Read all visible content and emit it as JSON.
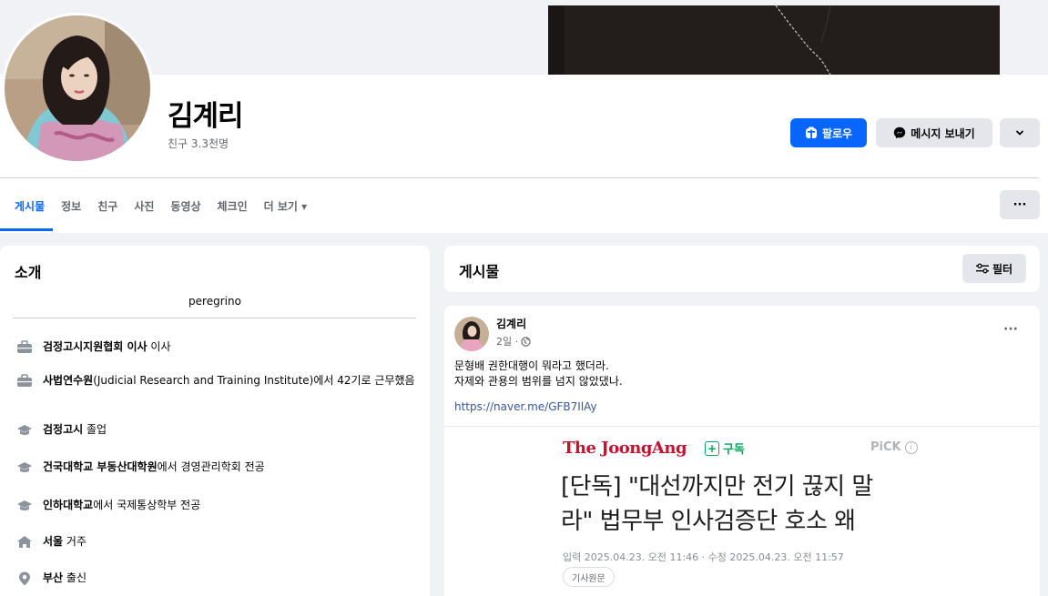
{
  "profile": {
    "name": "김계리",
    "friends": "친구 3.3천명",
    "follow_label": "팔로우",
    "message_label": "메시지 보내기"
  },
  "tabs": [
    {
      "label": "게시물",
      "active": true
    },
    {
      "label": "정보"
    },
    {
      "label": "친구"
    },
    {
      "label": "사진"
    },
    {
      "label": "동영상"
    },
    {
      "label": "체크인"
    },
    {
      "label": "더 보기 ▾"
    }
  ],
  "intro": {
    "title": "소개",
    "bio": "peregrino",
    "items": [
      {
        "icon": "briefcase-icon",
        "bold": "검정고시지원협회 이사",
        "rest": " 이사"
      },
      {
        "icon": "briefcase-icon",
        "bold": "사법연수원",
        "rest": "(Judicial Research and Training Institute)에서 42기로 근무했음"
      },
      {
        "icon": "graduation-cap-icon",
        "bold": "검정고시",
        "rest": " 졸업"
      },
      {
        "icon": "graduation-cap-icon",
        "bold": "건국대학교 부동산대학원",
        "rest": "에서 경영관리학회 전공"
      },
      {
        "icon": "graduation-cap-icon",
        "bold": "인하대학교",
        "rest": "에서 국제통상학부 전공"
      },
      {
        "icon": "home-icon",
        "bold": "서울",
        "rest": " 거주"
      },
      {
        "icon": "location-pin-icon",
        "bold": "부산",
        "rest": " 출신"
      }
    ]
  },
  "posts": {
    "title": "게시물",
    "filter_label": "필터"
  },
  "post": {
    "author": "김계리",
    "time": "2일 ·",
    "line1": "문형배 권한대행이 뭐라고 했더라.",
    "line2": "자제와 관용의 범위를 넘지 않았댔나.",
    "link": "https://naver.me/GFB7IlAy",
    "news": {
      "brand": "The JoongAng",
      "subscribe": "구독",
      "pick": "PiCK",
      "headline_1": "[단독] \"대선까지만 전기 끊지 말",
      "headline_2": "라\" 법무부 인사검증단 호소 왜",
      "date": "입력 2025.04.23. 오전 11:46 · 수정 2025.04.23. 오전 11:57",
      "original": "기사원문"
    }
  },
  "colors": {
    "accent": "#0866ff",
    "joongang_red": "#c4122f",
    "subscribe_green": "#00a862"
  }
}
